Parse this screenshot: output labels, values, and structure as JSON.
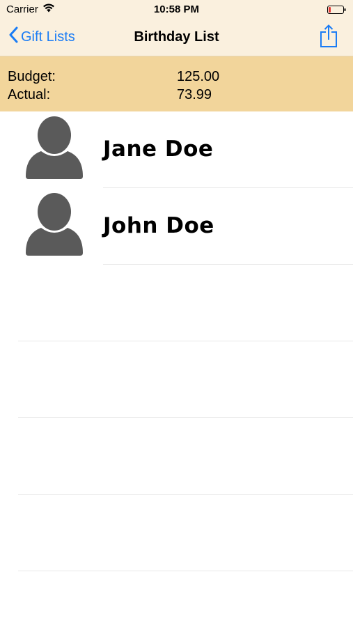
{
  "status_bar": {
    "carrier": "Carrier",
    "time": "10:58 PM",
    "icons": [
      "wifi-icon",
      "battery-low-icon"
    ]
  },
  "nav": {
    "back_label": "Gift Lists",
    "title": "Birthday List",
    "share_icon": "share-icon",
    "accent_color": "#1a7cf5"
  },
  "budget": {
    "budget_label": "Budget:",
    "budget_value": "125.00",
    "actual_label": "Actual:",
    "actual_value": "73.99"
  },
  "people": [
    {
      "name": "Jane Doe",
      "icon": "person-silhouette-icon"
    },
    {
      "name": "John Doe",
      "icon": "person-silhouette-icon"
    }
  ],
  "colors": {
    "nav_background": "#faf0de",
    "budget_background": "#f2d59b",
    "avatar": "#5a5a5a",
    "battery_low": "#e53935"
  }
}
